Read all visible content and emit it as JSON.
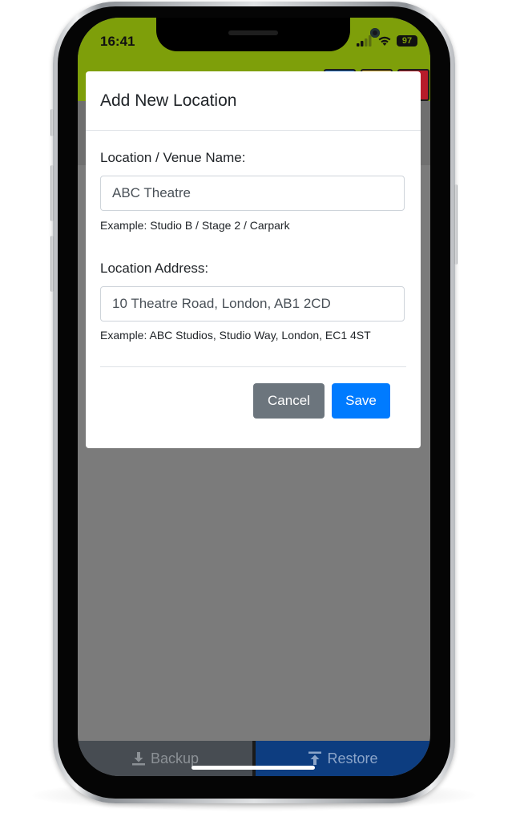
{
  "status_bar": {
    "time": "16:41",
    "battery": "97"
  },
  "modal": {
    "title": "Add New Location",
    "name_field": {
      "label": "Location / Venue Name:",
      "value": "ABC Theatre",
      "help": "Example: Studio B / Stage 2 / Carpark"
    },
    "address_field": {
      "label": "Location Address:",
      "value": "10 Theatre Road, London, AB1 2CD",
      "help": "Example: ABC Studios, Studio Way, London, EC1 4ST"
    },
    "cancel_label": "Cancel",
    "save_label": "Save"
  },
  "bottom_bar": {
    "backup_label": "Backup",
    "restore_label": "Restore"
  },
  "icons": {
    "backup": "download-icon",
    "restore": "upload-icon",
    "signal": "cellular-signal-icon",
    "wifi": "wifi-icon",
    "battery": "battery-icon"
  },
  "colors": {
    "header": "#7e9f0a",
    "primary": "#007bff",
    "secondary": "#6c757d",
    "backup_bar": "#474c52",
    "restore_bar": "#0d3d80"
  }
}
